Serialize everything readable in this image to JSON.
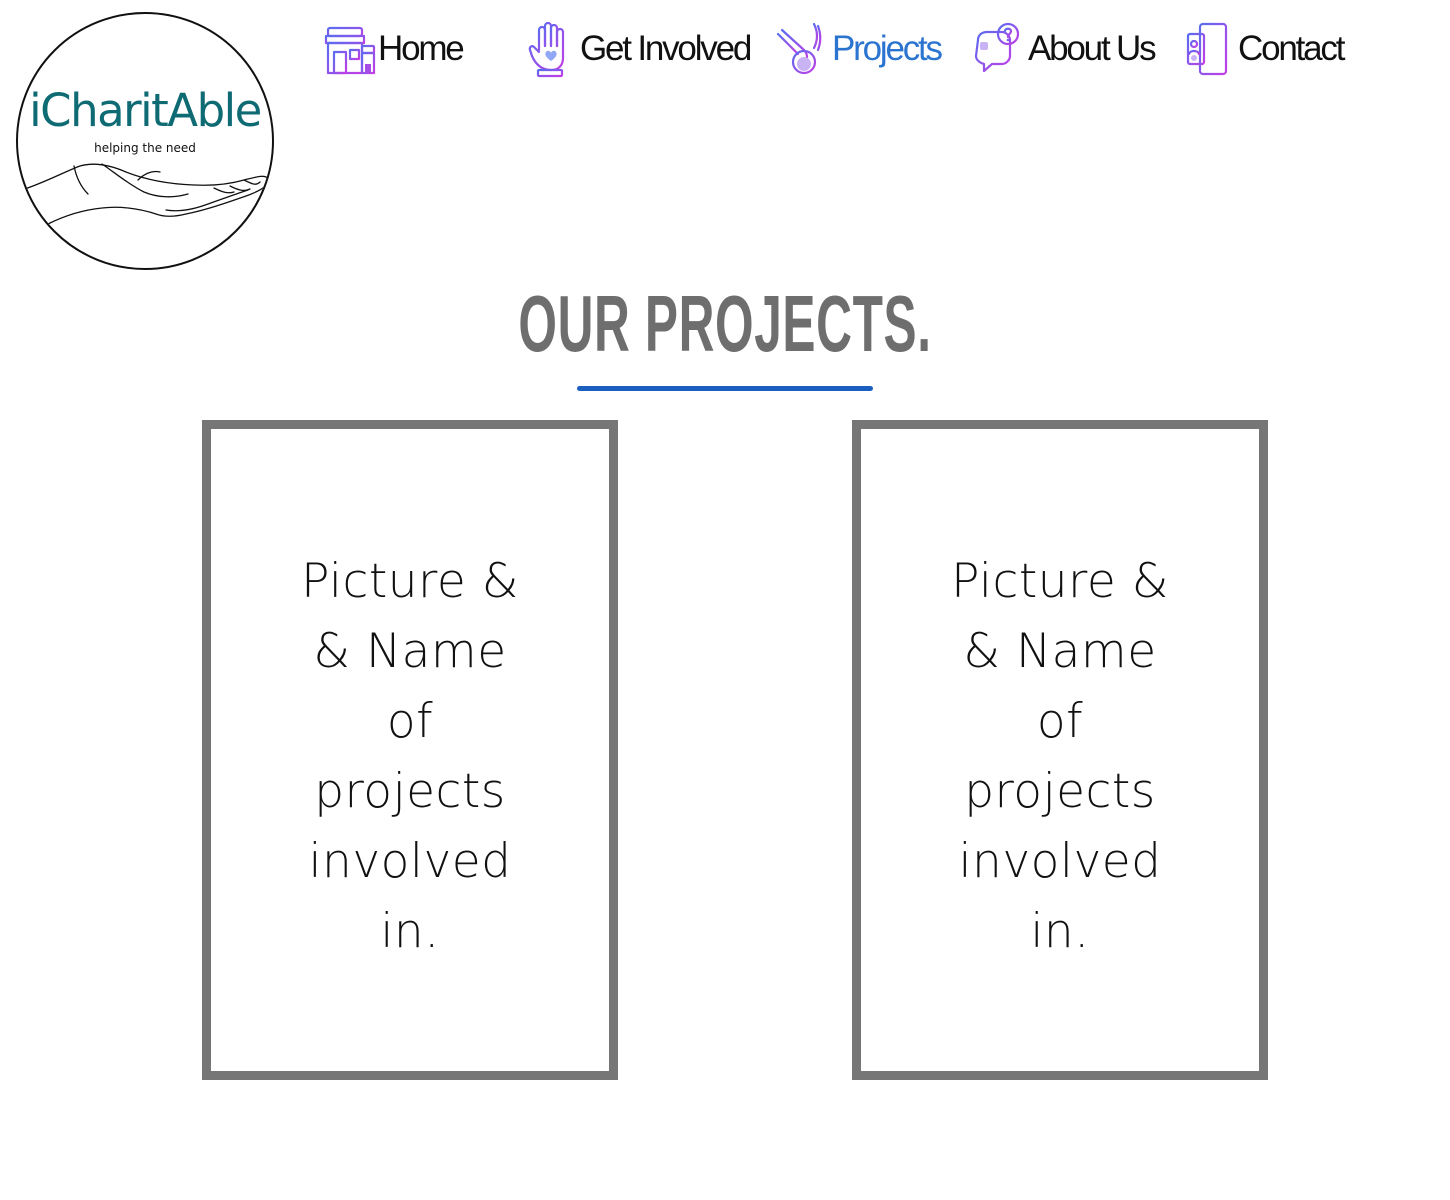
{
  "brand": {
    "name": "iCharitAble",
    "tagline": "helping the need",
    "color": "#0f6b73"
  },
  "nav": {
    "items": [
      {
        "label": "Home",
        "icon": "storefront-icon"
      },
      {
        "label": "Get Involved",
        "icon": "raised-hand-heart-icon"
      },
      {
        "label": "Projects",
        "icon": "brush-stroke-icon",
        "active": true
      },
      {
        "label": "About Us",
        "icon": "chat-question-icon"
      },
      {
        "label": "Contact",
        "icon": "address-book-icon"
      }
    ],
    "active_color": "#2b74d0",
    "icon_gradient": [
      "#5a6cf0",
      "#c23ee6"
    ]
  },
  "section": {
    "heading": "OUR PROJECTS.",
    "rule_color": "#1a5fbf"
  },
  "projects": [
    {
      "lines": [
        "Picture &",
        "& Name",
        "of",
        "projects",
        "involved",
        "in."
      ]
    },
    {
      "lines": [
        "Picture &",
        "& Name",
        "of",
        "projects",
        "involved",
        "in."
      ]
    }
  ]
}
